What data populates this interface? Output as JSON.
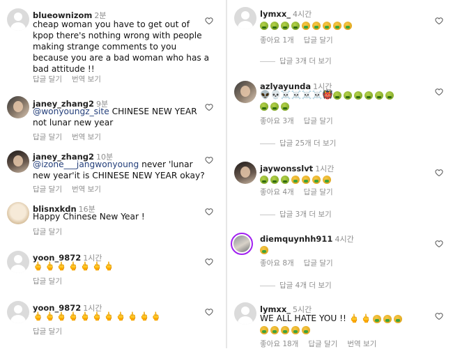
{
  "left": {
    "c1": {
      "user": "blueownizom",
      "time": "2분",
      "lines": [
        "cheap woman you have to get out of",
        "kpop there's nothing wrong with people",
        "making strange comments to you",
        "because you are a bad woman who has a",
        "bad attitude !!"
      ],
      "reply": "답글 달기",
      "translate": "번역 보기"
    },
    "c2": {
      "user": "janey_zhang2",
      "time": "9분",
      "mention": "@wonyoungz_site",
      "text1": " CHINESE NEW YEAR",
      "text2": "not lunar new year",
      "reply": "답글 달기",
      "translate": "번역 보기"
    },
    "c3": {
      "user": "janey_zhang2",
      "time": "10분",
      "mention": "@izone___jangwonyoung",
      "text1": " never 'lunar",
      "text2": "new year'it is CHINESE NEW YEAR okay?",
      "reply": "답글 달기",
      "translate": "번역 보기"
    },
    "c4": {
      "user": "blisnxkdn",
      "time": "16분",
      "text": "Happy Chinese New Year !",
      "reply": "답글 달기"
    },
    "c5": {
      "user": "yoon_9872",
      "time": "1시간",
      "emoji": "🖕🖕🖕🖕🖕🖕🖕",
      "reply": "답글 달기"
    },
    "c6": {
      "user": "yoon_9872",
      "time": "1시간",
      "emoji": "🖕🖕🖕🖕🖕🖕🖕🖕🖕🖕🖕",
      "reply": "답글 달기"
    }
  },
  "right": {
    "c1": {
      "user": "lymxx_",
      "time": "4시간",
      "likes": "좋아요 1개",
      "reply": "답글 달기",
      "more": "답글 3개 더 보기"
    },
    "c2": {
      "user": "azlyayunda",
      "time": "1시간",
      "emoji_top": "👽💀☠️☠️☠️☠️👹",
      "likes": "좋아요 3개",
      "reply": "답글 달기",
      "more": "답글 25개 더 보기"
    },
    "c3": {
      "user": "jaywonsslvt",
      "time": "1시간",
      "likes": "좋아요 4개",
      "reply": "답글 달기",
      "more": "답글 3개 더 보기"
    },
    "c4": {
      "user": "diemquynhh911",
      "time": "4시간",
      "likes": "좋아요 8개",
      "reply": "답글 달기",
      "more": "답글 4개 더 보기"
    },
    "c5": {
      "user": "lymxx_",
      "time": "5시간",
      "text": "WE ALL HATE YOU !! ",
      "emoji_mid": "🖕🖕",
      "likes": "좋아요 18개",
      "reply": "답글 달기",
      "translate": "번역 보기"
    }
  },
  "icons": {
    "like": "heart-outline-icon"
  }
}
